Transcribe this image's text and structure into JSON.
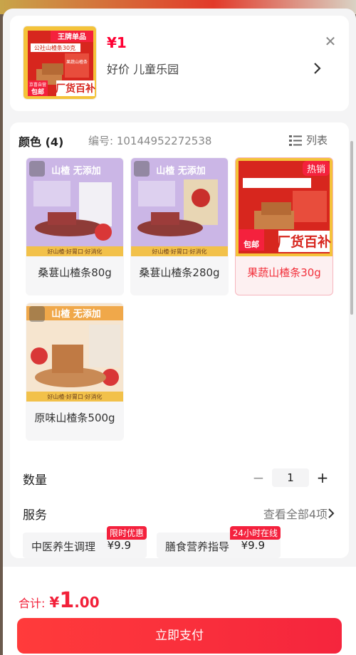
{
  "header": {
    "price": "¥1",
    "selected": "好价  儿童乐园",
    "close_icon": "close-icon",
    "thumb_badge": "王牌单品",
    "thumb_brand": "公社山楂条30克",
    "thumb_sub": "果蔬山楂条",
    "thumb_slogan": "厂货百补",
    "thumb_ship_top": "京喜自营",
    "thumb_ship": "包邮"
  },
  "options": {
    "title": "颜色 (4)",
    "code": "编号: 10144952272538",
    "list_label": "列表",
    "items": [
      {
        "label": "桑葚山楂条80g",
        "banner": "山楂 无添加",
        "footer": "好山楂·好胃口·好消化",
        "active": false
      },
      {
        "label": "桑葚山楂条280g",
        "banner": "山楂 无添加",
        "footer": "好山楂·好胃口·好消化",
        "active": false
      },
      {
        "label": "果蔬山楂条30g",
        "hot": "热销",
        "active": true
      },
      {
        "label": "原味山楂条500g",
        "banner": "山楂 无添加",
        "footer": "好山楂·好胃口·好消化",
        "active": false
      }
    ]
  },
  "quantity": {
    "label": "数量",
    "value": "1",
    "minus": "−",
    "plus": "+"
  },
  "service": {
    "label": "服务",
    "view_all": "查看全部4项",
    "items": [
      {
        "name": "中医养生调理",
        "price": "¥9.9",
        "tag": "限时优惠"
      },
      {
        "name": "膳食营养指导",
        "price": "¥9.9",
        "tag": "24小时在线"
      }
    ]
  },
  "footer": {
    "total_label": "合计:",
    "currency": "¥",
    "total_int": "1",
    "total_dec": ".00",
    "pay_label": "立即支付"
  },
  "colors": {
    "accent": "#f2213a",
    "hot": "#f4213d"
  }
}
